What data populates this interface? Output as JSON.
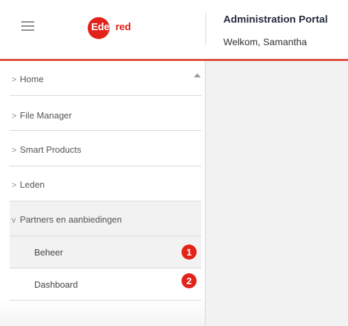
{
  "header": {
    "logo_text_white": "Eden",
    "logo_text_red": "red",
    "portal_title": "Administration Portal",
    "welcome": "Welkom, Samantha",
    "accent_color": "#e2231a"
  },
  "sidebar": {
    "items": [
      {
        "chevron": ">",
        "label": "Home"
      },
      {
        "chevron": ">",
        "label": "File Manager"
      },
      {
        "chevron": ">",
        "label": "Smart Products"
      },
      {
        "chevron": ">",
        "label": "Leden"
      },
      {
        "chevron": "v",
        "label": "Partners en aanbiedingen"
      }
    ],
    "subitems": [
      {
        "label": "Beheer",
        "badge": "1"
      },
      {
        "label": "Dashboard",
        "badge": "2"
      }
    ]
  },
  "icons": {
    "menu": "hamburger-icon",
    "scroll": "scroll-up-arrow-icon"
  }
}
